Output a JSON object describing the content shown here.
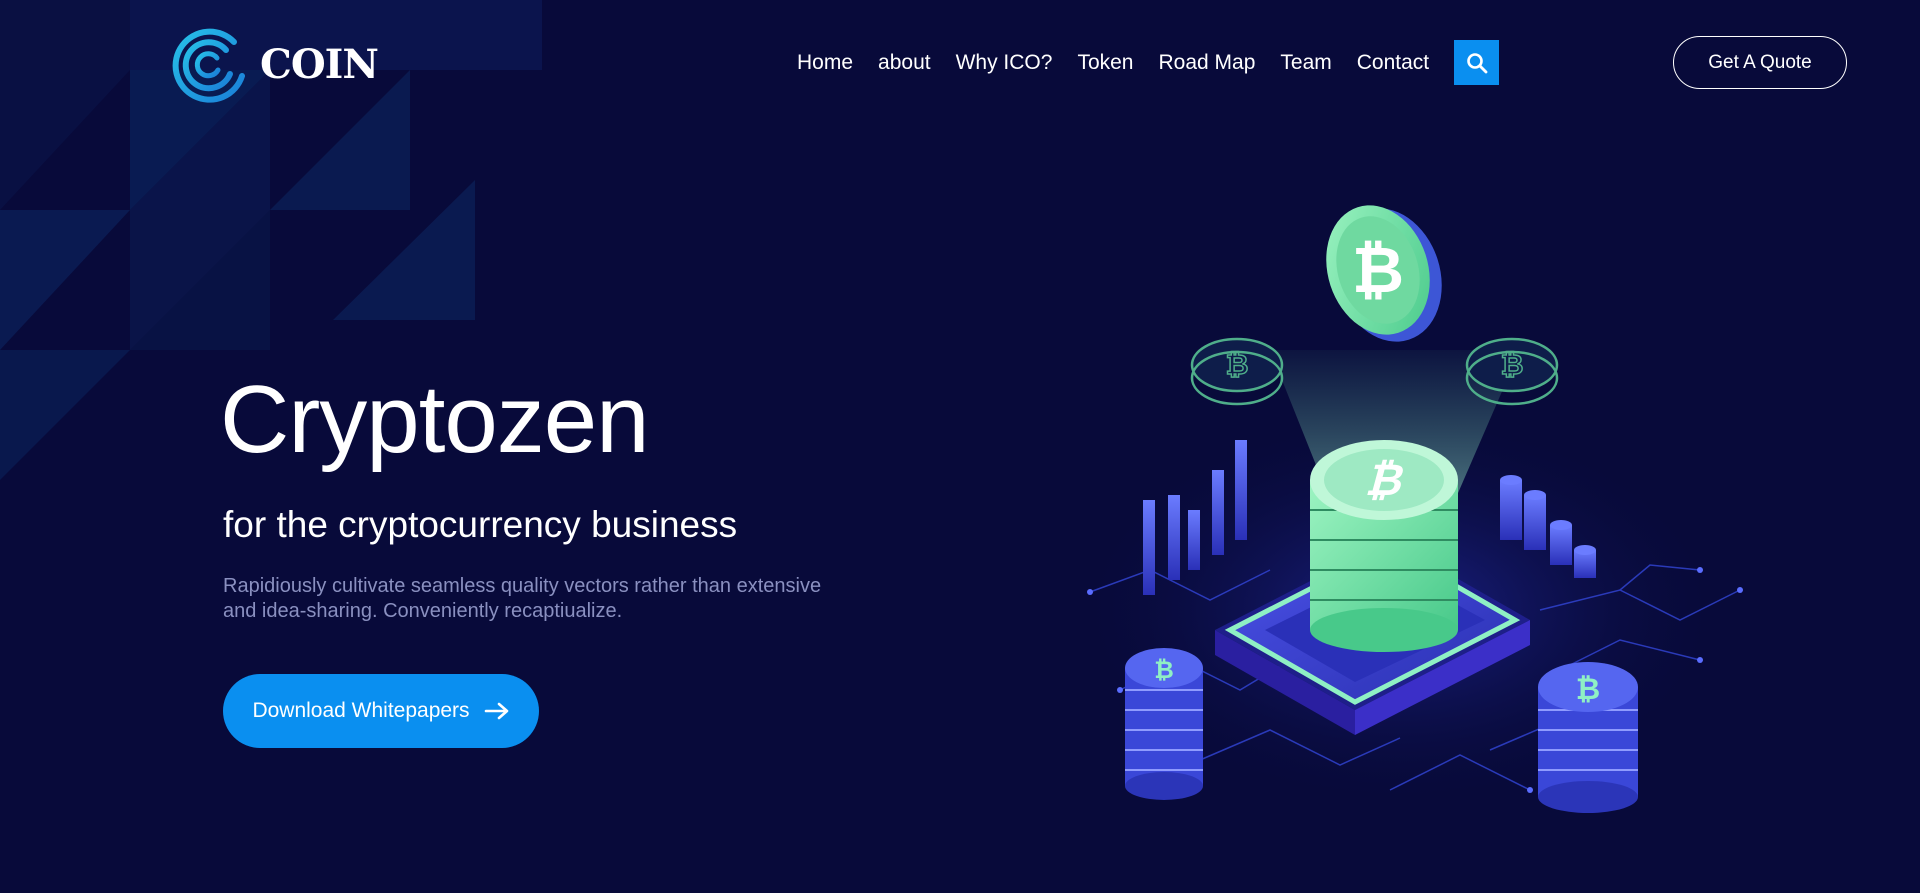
{
  "brand": {
    "name": "COIN"
  },
  "nav": {
    "items": [
      {
        "label": "Home"
      },
      {
        "label": "about"
      },
      {
        "label": "Why ICO?"
      },
      {
        "label": "Token"
      },
      {
        "label": "Road Map"
      },
      {
        "label": "Team"
      },
      {
        "label": "Contact"
      }
    ],
    "search_icon": "search-icon",
    "quote_label": "Get A Quote"
  },
  "hero": {
    "title": "Cryptozen",
    "subtitle": "for the cryptocurrency business",
    "description": "Rapidiously cultivate seamless quality vectors rather than extensive and idea-sharing. Conveniently recaptiualize.",
    "cta_label": "Download Whitepapers",
    "cta_icon": "arrow-right-icon"
  },
  "colors": {
    "background": "#080a3a",
    "accent": "#0a8ff0",
    "coin_green": "#7ee8a6",
    "platform_blue": "#3a3fd8"
  }
}
